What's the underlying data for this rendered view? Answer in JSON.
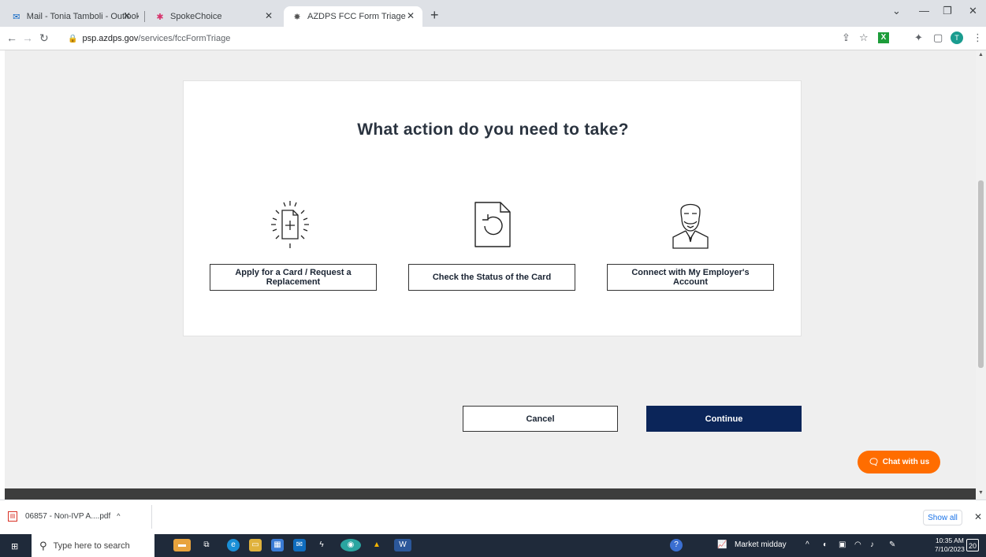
{
  "browser": {
    "tabs": [
      {
        "title": "Mail - Tonia Tamboli - Outlook"
      },
      {
        "title": "SpokeChoice"
      },
      {
        "title": "AZDPS FCC Form Triage"
      }
    ],
    "url_host": "psp.azdps.gov",
    "url_path": "/services/fccFormTriage"
  },
  "page": {
    "question": "What action do you need to take?",
    "options": [
      {
        "label": "Apply for a Card / Request a Replacement"
      },
      {
        "label": "Check the Status of the Card"
      },
      {
        "label": "Connect with My Employer's Account"
      }
    ],
    "cancel_label": "Cancel",
    "continue_label": "Continue",
    "chat_label": "Chat with us"
  },
  "downloads": {
    "file": "06857 - Non-IVP A....pdf",
    "show_all": "Show all"
  },
  "taskbar": {
    "search_placeholder": "Type here to search",
    "news": "Market midday",
    "time": "10:35 AM",
    "date": "7/10/2023",
    "notifications": "20"
  },
  "colors": {
    "primary": "#0b2559",
    "chat": "#ff6d00",
    "page_bg": "#efefef"
  }
}
